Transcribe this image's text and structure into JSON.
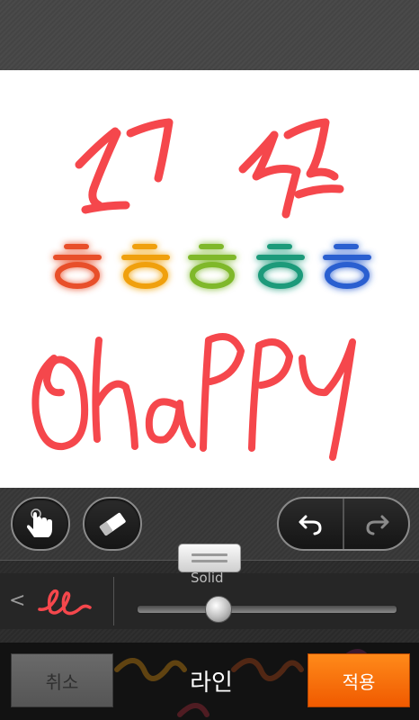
{
  "canvas": {
    "stroke_color": "#f5474c",
    "rainbow_colors": [
      "#e8502a",
      "#f0a010",
      "#7fb82a",
      "#1a9a7a",
      "#2b5ed0"
    ]
  },
  "toolbar": {
    "icons": [
      "hand-touch-icon",
      "eraser-icon",
      "undo-icon",
      "redo-icon"
    ]
  },
  "line_settings": {
    "preview_icon": "red-line-preview-icon",
    "style_label": "Solid",
    "thickness_level": 0.31
  },
  "bottom": {
    "cancel_label": "취소",
    "title": "라인",
    "apply_label": "적용",
    "apply_color": "#f56a00"
  }
}
